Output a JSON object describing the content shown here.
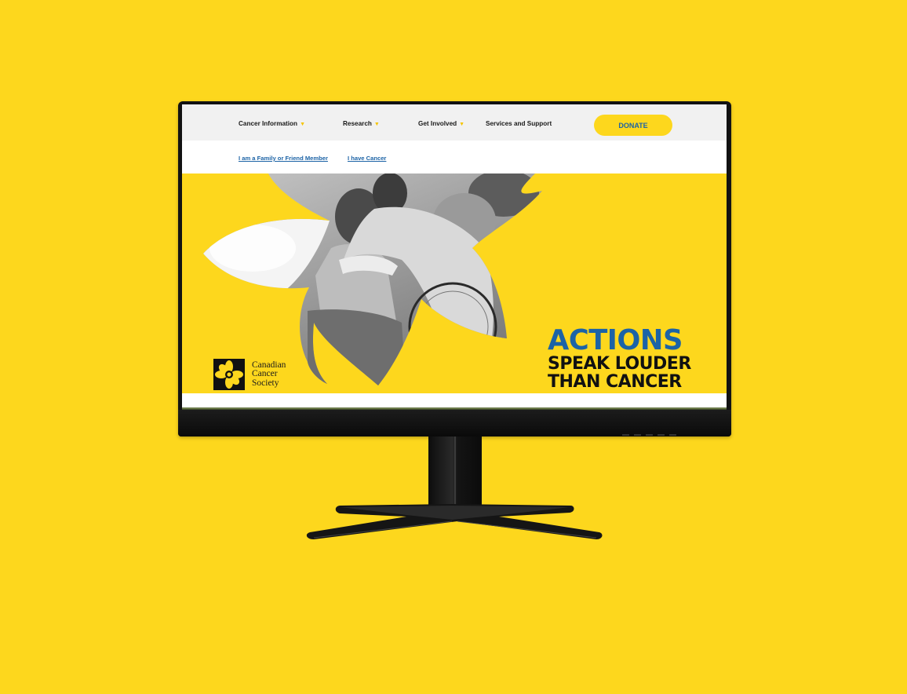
{
  "nav": {
    "items": [
      {
        "label": "Cancer Information",
        "has_dropdown": true
      },
      {
        "label": "Research",
        "has_dropdown": true
      },
      {
        "label": "Get Involved",
        "has_dropdown": true
      },
      {
        "label": "Services and Support",
        "has_dropdown": false
      }
    ],
    "caret": "▼",
    "donate_label": "DONATE"
  },
  "subnav": {
    "links": [
      {
        "label": "I am a Family or Friend Member"
      },
      {
        "label": "I have Cancer"
      }
    ]
  },
  "hero": {
    "headline_1": "ACTIONS",
    "headline_2": "SPEAK LOUDER",
    "headline_3": "THAN CANCER",
    "photo_icon": "daffodil-photo-collage"
  },
  "brand": {
    "name_line_1": "Canadian",
    "name_line_2": "Cancer",
    "name_line_3": "Society",
    "logo_icon": "daffodil-logo-icon"
  },
  "colors": {
    "background": "#fdd71d",
    "accent_yellow": "#fdd71d",
    "link_blue": "#1c63a6",
    "text_dark": "#111111",
    "monitor_black": "#121212"
  }
}
